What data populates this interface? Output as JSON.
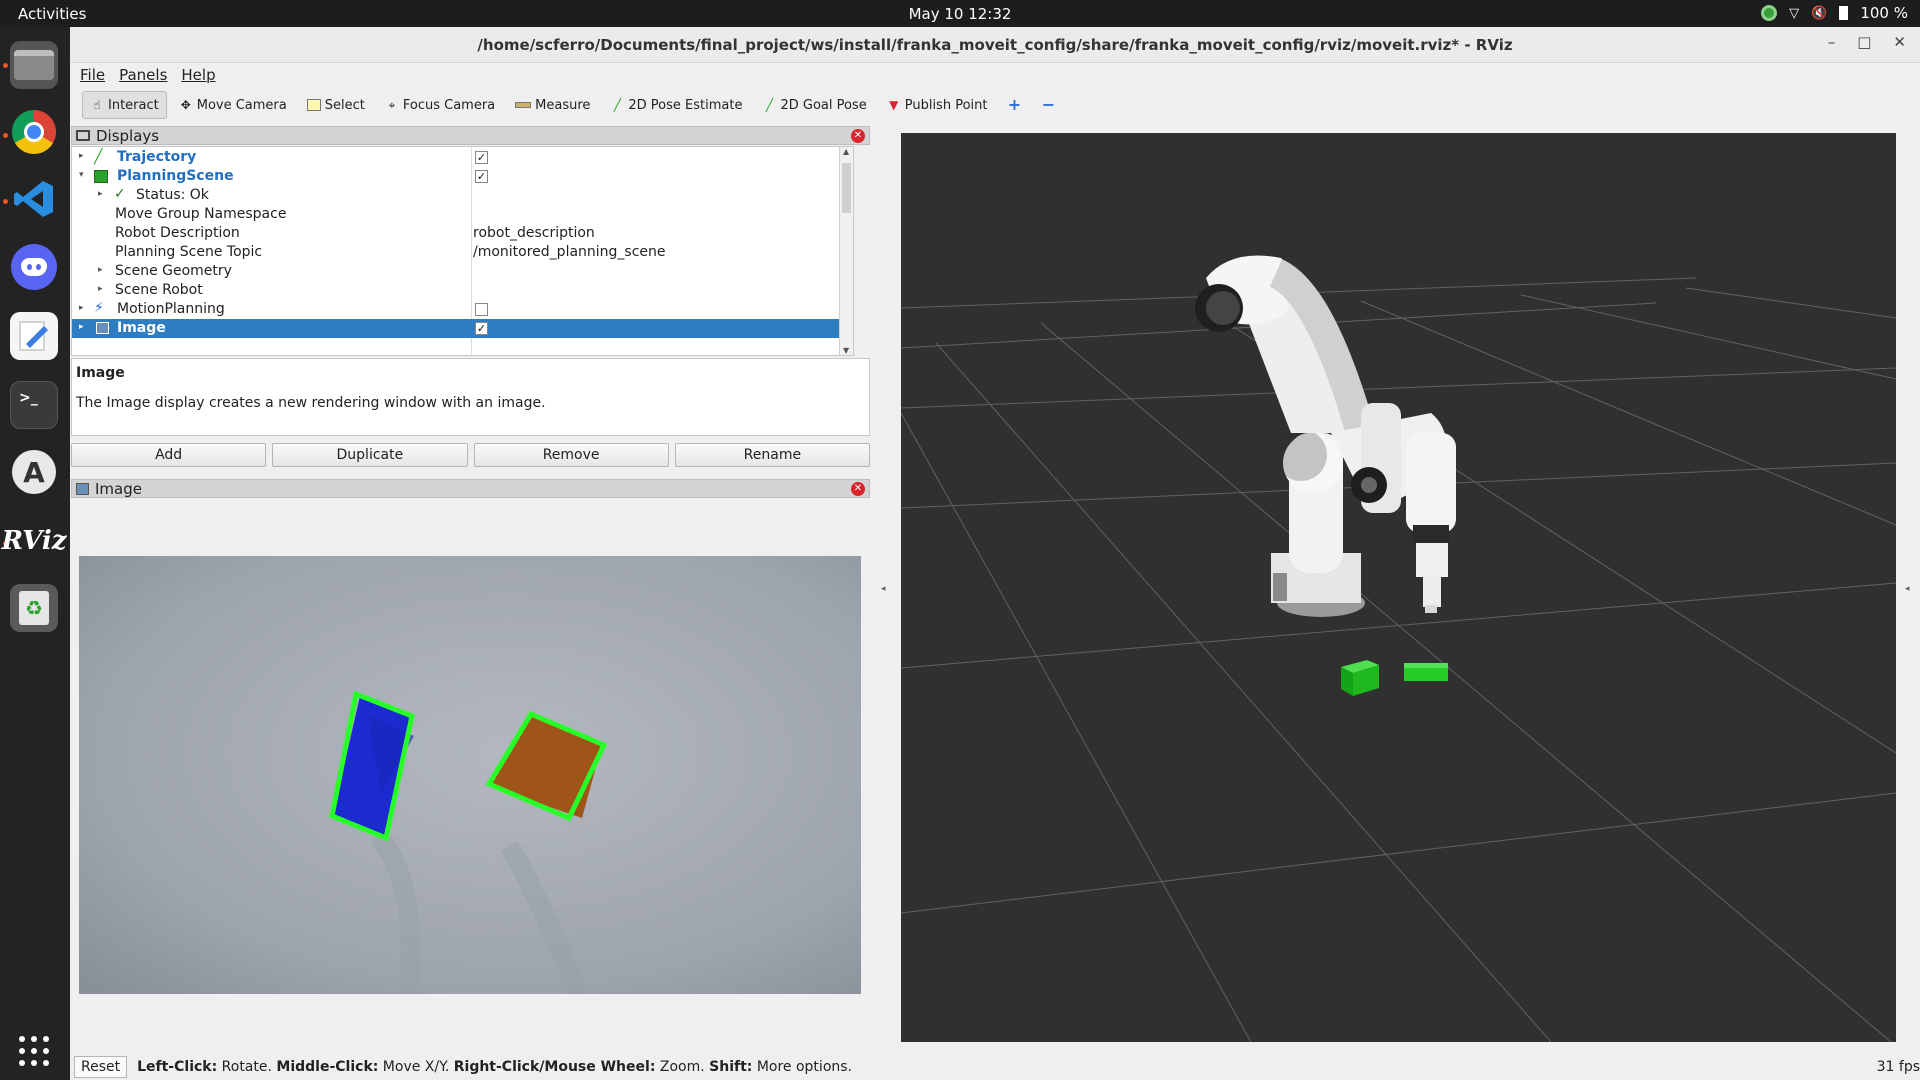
{
  "topbar": {
    "activities": "Activities",
    "clock": "May 10  12:32",
    "battery": "100 %"
  },
  "window": {
    "title": "/home/scferro/Documents/final_project/ws/install/franka_moveit_config/share/franka_moveit_config/rviz/moveit.rviz* - RViz"
  },
  "menu": {
    "file": "File",
    "panels": "Panels",
    "help": "Help"
  },
  "toolbar": {
    "interact": "Interact",
    "move_camera": "Move Camera",
    "select": "Select",
    "focus_camera": "Focus Camera",
    "measure": "Measure",
    "pose_estimate": "2D Pose Estimate",
    "goal_pose": "2D Goal Pose",
    "publish_point": "Publish Point"
  },
  "displays": {
    "title": "Displays",
    "rows": {
      "trajectory": "Trajectory",
      "planning_scene": "PlanningScene",
      "status": "Status: Ok",
      "move_group_ns": "Move Group Namespace",
      "robot_desc": "Robot Description",
      "robot_desc_val": "robot_description",
      "ps_topic": "Planning Scene Topic",
      "ps_topic_val": "/monitored_planning_scene",
      "scene_geometry": "Scene Geometry",
      "scene_robot": "Scene Robot",
      "motion_planning": "MotionPlanning",
      "image": "Image"
    },
    "desc_title": "Image",
    "desc_text": "The Image display creates a new rendering window with an image.",
    "buttons": {
      "add": "Add",
      "duplicate": "Duplicate",
      "remove": "Remove",
      "rename": "Rename"
    }
  },
  "image_panel": {
    "title": "Image"
  },
  "status": {
    "reset": "Reset",
    "left_click": "Left-Click:",
    "left_click_desc": " Rotate. ",
    "middle_click": "Middle-Click:",
    "middle_click_desc": " Move X/Y. ",
    "right_click": "Right-Click/Mouse Wheel:",
    "right_click_desc": " Zoom. ",
    "shift": "Shift:",
    "shift_desc": " More options.",
    "fps": "31 fps"
  },
  "dock_icons": [
    "files-icon",
    "chrome-icon",
    "vscode-icon",
    "discord-icon",
    "text-editor-icon",
    "terminal-icon",
    "software-icon",
    "rviz-icon",
    "trash-icon",
    "app-grid-icon"
  ],
  "colors": {
    "selection": "#2f7dc1",
    "accent_green": "#22cc22",
    "view_bg": "#303030"
  }
}
